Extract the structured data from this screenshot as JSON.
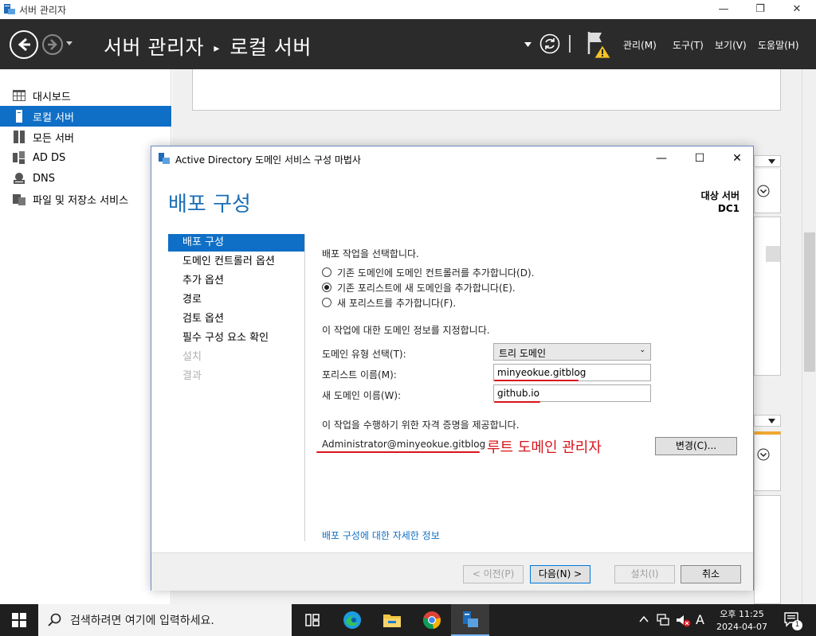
{
  "window": {
    "title": "서버 관리자",
    "minimize": "—",
    "restore": "❐",
    "close": "✕"
  },
  "header": {
    "breadcrumb_root": "서버 관리자",
    "breadcrumb_sep": "▸",
    "breadcrumb_current": "로컬 서버",
    "menu": [
      "관리(M)",
      "도구(T)",
      "보기(V)",
      "도움말(H)"
    ]
  },
  "leftnav": {
    "items": [
      {
        "label": "대시보드",
        "icon": "dashboard-icon",
        "active": false
      },
      {
        "label": "로컬 서버",
        "icon": "server-icon",
        "active": true
      },
      {
        "label": "모든 서버",
        "icon": "servers-icon",
        "active": false
      },
      {
        "label": "AD DS",
        "icon": "adds-icon",
        "active": false
      },
      {
        "label": "DNS",
        "icon": "dns-icon",
        "active": false
      },
      {
        "label": "파일 및 저장소 서비스",
        "icon": "storage-icon",
        "active": false
      }
    ]
  },
  "dialog": {
    "title": "Active Directory 도메인 서비스 구성 마법사",
    "heading": "배포 구성",
    "target_label": "대상 서버",
    "target_value": "DC1",
    "steps": [
      {
        "label": "배포 구성",
        "state": "active"
      },
      {
        "label": "도메인 컨트롤러 옵션",
        "state": "normal"
      },
      {
        "label": "추가 옵션",
        "state": "normal"
      },
      {
        "label": "경로",
        "state": "normal"
      },
      {
        "label": "검토 옵션",
        "state": "normal"
      },
      {
        "label": "필수 구성 요소 확인",
        "state": "normal"
      },
      {
        "label": "설치",
        "state": "disabled"
      },
      {
        "label": "결과",
        "state": "disabled"
      }
    ],
    "op_prompt": "배포 작업을 선택합니다.",
    "radios": [
      {
        "label": "기존 도메인에 도메인 컨트롤러를 추가합니다(D).",
        "selected": false
      },
      {
        "label": "기존 포리스트에 새 도메인을 추가합니다(E).",
        "selected": true
      },
      {
        "label": "새 포리스트를 추가합니다(F).",
        "selected": false
      }
    ],
    "domain_info_prompt": "이 작업에 대한 도메인 정보를 지정합니다.",
    "domain_type_label": "도메인 유형 선택(T):",
    "domain_type_value": "트리 도메인",
    "forest_name_label": "포리스트 이름(M):",
    "forest_name_value": "minyeokue.gitblog",
    "new_domain_label": "새 도메인 이름(W):",
    "new_domain_value": "github.io",
    "cred_prompt": "이 작업을 수행하기 위한 자격 증명을 제공합니다.",
    "cred_value": "Administrator@minyeokue.gitblog",
    "annotation": "루트 도메인 관리자",
    "change_button": "변경(C)...",
    "more_info_link": "배포 구성에 대한 자세한 정보",
    "buttons": {
      "prev": "< 이전(P)",
      "next": "다음(N) >",
      "install": "설치(I)",
      "cancel": "취소"
    },
    "annotation_color": "#d8141b"
  },
  "taskbar": {
    "search_placeholder": "검색하려면 여기에 입력하세요.",
    "time": "오후 11:25",
    "date": "2024-04-07",
    "ime": "A",
    "notification_count": "1"
  },
  "colors": {
    "accent": "#0f6fc6",
    "header_bg": "#2b2b2b",
    "warning": "#f7c325"
  }
}
